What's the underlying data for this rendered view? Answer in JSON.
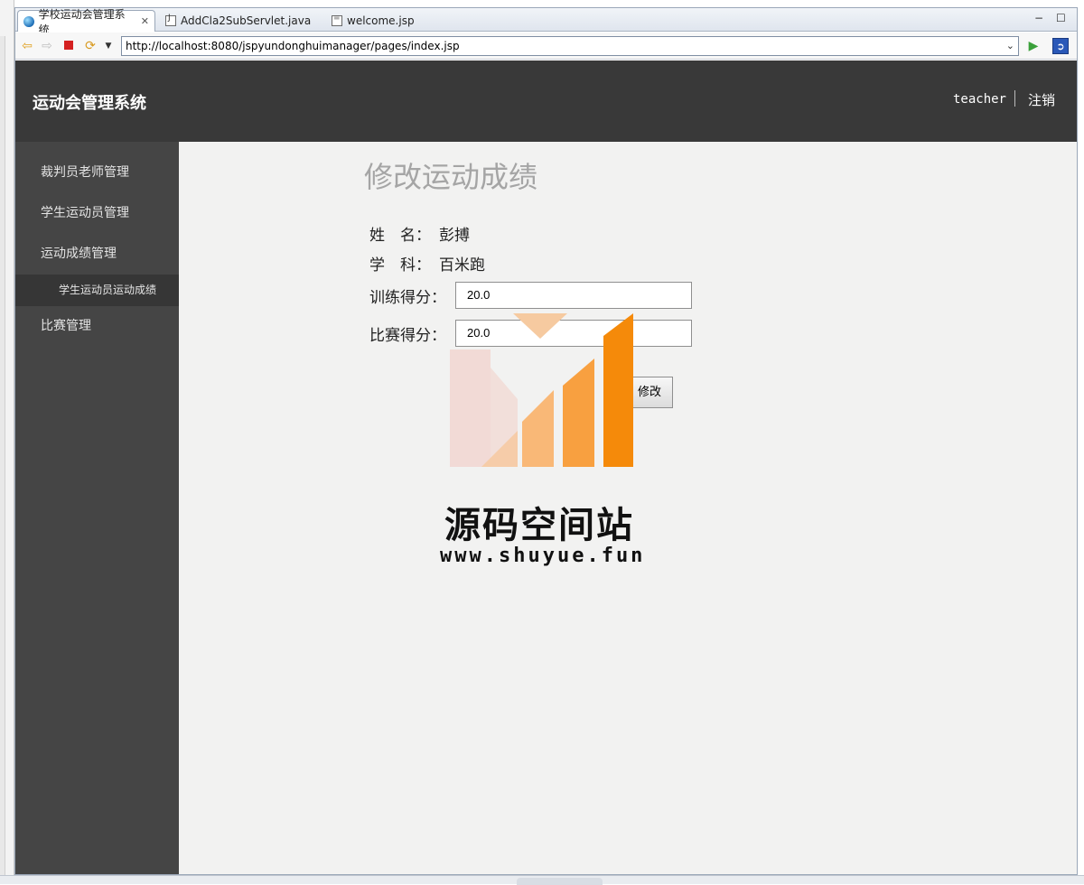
{
  "browser": {
    "tabs": [
      {
        "label": "学校运动会管理系统",
        "icon": "globe-icon",
        "active": true
      },
      {
        "label": "AddCla2SubServlet.java",
        "icon": "java-file-icon",
        "active": false
      },
      {
        "label": "welcome.jsp",
        "icon": "jsp-file-icon",
        "active": false
      }
    ],
    "url": "http://localhost:8080/jspyundonghuimanager/pages/index.jsp",
    "minimize_glyph": "−",
    "maximize_glyph": "☐"
  },
  "header": {
    "brand": "运动会管理系统",
    "user": "teacher",
    "logout": "注销",
    "background": "#393939"
  },
  "sidebar": {
    "background": "#454545",
    "items": [
      {
        "label": "裁判员老师管理"
      },
      {
        "label": "学生运动员管理"
      },
      {
        "label": "运动成绩管理"
      },
      {
        "label": "学生运动员运动成绩",
        "sub": true
      },
      {
        "label": "比赛管理"
      }
    ]
  },
  "form": {
    "title": "修改运动成绩",
    "name_label": "姓　名：",
    "name_value": "彭搏",
    "subject_label": "学　科：",
    "subject_value": "百米跑",
    "train_label": "训练得分：",
    "train_value": "20.0",
    "match_label": "比赛得分：",
    "match_value": "20.0",
    "submit_label": "修改"
  },
  "watermark": {
    "name": "源码空间站",
    "url": "www.shuyue.fun"
  }
}
